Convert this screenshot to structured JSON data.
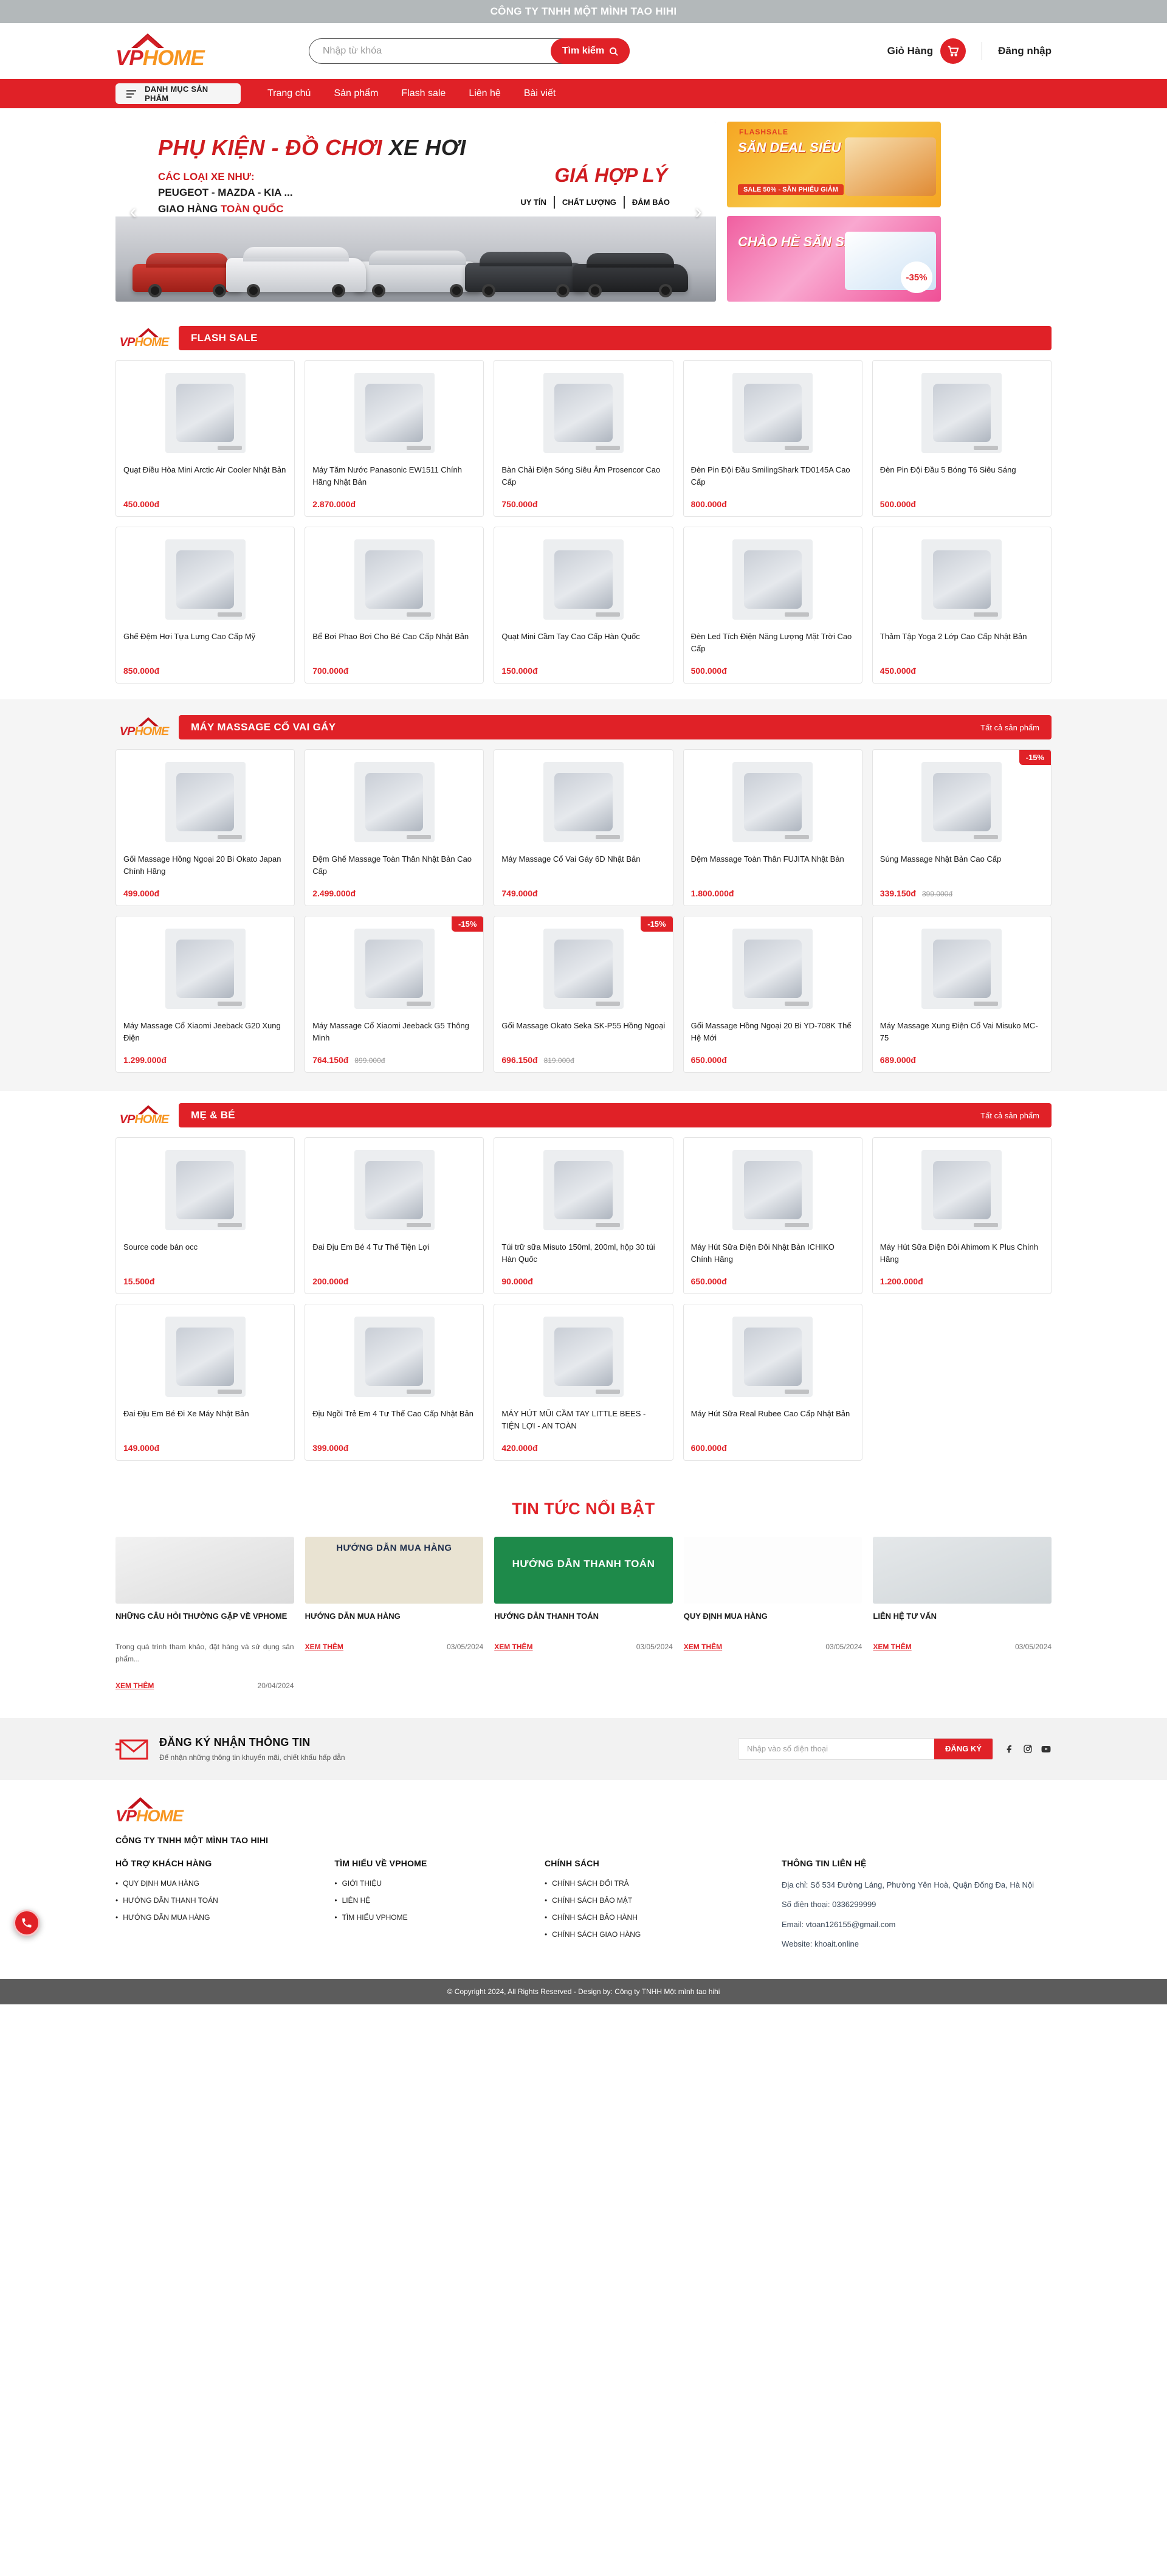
{
  "topbar": {
    "text": "CÔNG TY TNHH MỘT MÌNH TAO HIHI"
  },
  "brand": {
    "vp": "VP",
    "home": "HOME"
  },
  "search": {
    "placeholder": "Nhập từ khóa",
    "value": "",
    "button": "Tìm kiếm"
  },
  "header": {
    "cart_label": "Giỏ Hàng",
    "login_label": "Đăng nhập"
  },
  "nav": {
    "category_button": "DANH MỤC SẢN PHẨM",
    "links": [
      "Trang chủ",
      "Sản phẩm",
      "Flash sale",
      "Liên hệ",
      "Bài viết"
    ]
  },
  "banner": {
    "slide_title_red": "PHỤ KIỆN - ĐỒ CHƠI ",
    "slide_title_dark": "XE HƠI",
    "slide_sub_line1_red": "CÁC LOẠI XE NHƯ:",
    "slide_sub_line2": "PEUGEOT - MAZDA - KIA ...",
    "slide_sub_line3_pre": "GIAO HÀNG ",
    "slide_sub_line3_red": "TOÀN QUỐC",
    "slide_price": "GIÁ HỢP LÝ",
    "tags": [
      "UY TÍN",
      "CHẤT LƯỢNG",
      "ĐẢM BẢO"
    ],
    "side1_top": "FLASHSALE",
    "side1_title": "SĂN DEAL SIÊU KHỦNG",
    "side1_sub": "SALE 50% - SĂN PHIẾU GIẢM",
    "side2_title": "CHÀO HÈ SĂN SALE",
    "side2_badge": "-35%"
  },
  "flash_sale": {
    "title": "FLASH SALE",
    "products": [
      {
        "name": "Quạt Điều Hòa Mini Arctic Air Cooler Nhật Bản",
        "price": "450.000đ",
        "old_price": "",
        "discount": ""
      },
      {
        "name": "Máy Tăm Nước Panasonic EW1511 Chính Hãng Nhật Bản",
        "price": "2.870.000đ",
        "old_price": "",
        "discount": ""
      },
      {
        "name": "Bàn Chải Điện Sóng Siêu Âm Prosencor Cao Cấp",
        "price": "750.000đ",
        "old_price": "",
        "discount": ""
      },
      {
        "name": "Đèn Pin Đội Đầu SmilingShark TD0145A Cao Cấp",
        "price": "800.000đ",
        "old_price": "",
        "discount": ""
      },
      {
        "name": "Đèn Pin Đội Đầu 5 Bóng T6 Siêu Sáng",
        "price": "500.000đ",
        "old_price": "",
        "discount": ""
      },
      {
        "name": "Ghế Đệm Hơi Tựa Lưng Cao Cấp Mỹ",
        "price": "850.000đ",
        "old_price": "",
        "discount": ""
      },
      {
        "name": "Bể Bơi Phao Bơi Cho Bé Cao Cấp Nhật Bản",
        "price": "700.000đ",
        "old_price": "",
        "discount": ""
      },
      {
        "name": "Quạt Mini Cầm Tay Cao Cấp Hàn Quốc",
        "price": "150.000đ",
        "old_price": "",
        "discount": ""
      },
      {
        "name": "Đèn Led Tích Điện Năng Lượng Mặt Trời Cao Cấp",
        "price": "500.000đ",
        "old_price": "",
        "discount": ""
      },
      {
        "name": "Thảm Tập Yoga 2 Lớp Cao Cấp Nhật Bản",
        "price": "450.000đ",
        "old_price": "",
        "discount": ""
      }
    ]
  },
  "massage": {
    "title": "MÁY MASSAGE CỔ VAI GÁY",
    "all_label": "Tất cả sản phẩm",
    "products": [
      {
        "name": "Gối Massage Hồng Ngoại 20 Bi Okato Japan Chính Hãng",
        "price": "499.000đ",
        "old_price": "",
        "discount": ""
      },
      {
        "name": "Đệm Ghế Massage Toàn Thân Nhật Bản Cao Cấp",
        "price": "2.499.000đ",
        "old_price": "",
        "discount": ""
      },
      {
        "name": "Máy Massage Cổ Vai Gáy 6D Nhật Bản",
        "price": "749.000đ",
        "old_price": "",
        "discount": ""
      },
      {
        "name": "Đệm Massage Toàn Thân FUJITA Nhật Bản",
        "price": "1.800.000đ",
        "old_price": "",
        "discount": ""
      },
      {
        "name": "Súng Massage Nhật Bản Cao Cấp",
        "price": "339.150đ",
        "old_price": "399.000đ",
        "discount": "-15%"
      },
      {
        "name": "Máy Massage Cổ Xiaomi Jeeback G20 Xung Điện",
        "price": "1.299.000đ",
        "old_price": "",
        "discount": ""
      },
      {
        "name": "Máy Massage Cổ Xiaomi Jeeback G5 Thông Minh",
        "price": "764.150đ",
        "old_price": "899.000đ",
        "discount": "-15%"
      },
      {
        "name": "Gối Massage Okato Seka SK-P55 Hồng Ngoại",
        "price": "696.150đ",
        "old_price": "819.000đ",
        "discount": "-15%"
      },
      {
        "name": "Gối Massage Hồng Ngoại 20 Bi YD-708K Thế Hệ Mới",
        "price": "650.000đ",
        "old_price": "",
        "discount": ""
      },
      {
        "name": "Máy Massage Xung Điện Cổ Vai Misuko MC-75",
        "price": "689.000đ",
        "old_price": "",
        "discount": ""
      }
    ]
  },
  "baby": {
    "title": "MẸ & BÉ",
    "all_label": "Tất cả sản phẩm",
    "products": [
      {
        "name": "Source code bán occ",
        "price": "15.500đ",
        "old_price": "",
        "discount": ""
      },
      {
        "name": "Đai Địu Em Bé 4 Tư Thế Tiện Lợi",
        "price": "200.000đ",
        "old_price": "",
        "discount": ""
      },
      {
        "name": "Túi trữ sữa Misuto 150ml, 200ml, hộp 30 túi Hàn Quốc",
        "price": "90.000đ",
        "old_price": "",
        "discount": ""
      },
      {
        "name": "Máy Hút Sữa Điện Đôi Nhật Bản ICHIKO Chính Hãng",
        "price": "650.000đ",
        "old_price": "",
        "discount": ""
      },
      {
        "name": "Máy Hút Sữa Điện Đôi Ahimom K Plus Chính Hãng",
        "price": "1.200.000đ",
        "old_price": "",
        "discount": ""
      },
      {
        "name": "Đai Địu Em Bé Đi Xe Máy Nhật Bản",
        "price": "149.000đ",
        "old_price": "",
        "discount": ""
      },
      {
        "name": "Địu Ngồi Trẻ Em 4 Tư Thế Cao Cấp Nhật Bản",
        "price": "399.000đ",
        "old_price": "",
        "discount": ""
      },
      {
        "name": "MÁY HÚT MŨI CẦM TAY LITTLE BEES - TIỆN LỢI - AN TOÀN",
        "price": "420.000đ",
        "old_price": "",
        "discount": ""
      },
      {
        "name": "Máy Hút Sữa Real Rubee Cao Cấp Nhật Bản",
        "price": "600.000đ",
        "old_price": "",
        "discount": ""
      }
    ]
  },
  "news": {
    "title": "TIN TỨC NỔI BẬT",
    "more_label": "XEM THÊM",
    "items": [
      {
        "caption": "",
        "name": "NHỮNG CÂU HỎI THƯỜNG GẶP VỀ VPHOME",
        "excerpt": "Trong quá trình tham khảo, đặt hàng và sử dụng sản phẩm...",
        "date": "20/04/2024"
      },
      {
        "caption": "HƯỚNG DẪN MUA HÀNG",
        "name": "HƯỚNG DẪN MUA HÀNG",
        "excerpt": "",
        "date": "03/05/2024"
      },
      {
        "caption": "HƯỚNG DẪN THANH TOÁN",
        "name": "HƯỚNG DẪN THANH TOÁN",
        "excerpt": "",
        "date": "03/05/2024"
      },
      {
        "caption": "",
        "name": "QUY ĐỊNH MUA HÀNG",
        "excerpt": "",
        "date": "03/05/2024"
      },
      {
        "caption": "",
        "name": "LIÊN HỆ TƯ VẤN",
        "excerpt": "",
        "date": "03/05/2024"
      }
    ]
  },
  "newsletter": {
    "title": "ĐĂNG KÝ NHẬN THÔNG TIN",
    "subtitle": "Để nhận những thông tin khuyến mãi, chiết khấu hấp dẫn",
    "placeholder": "Nhập vào số điện thoại",
    "button": "ĐĂNG KÝ"
  },
  "footer": {
    "company": "CÔNG TY TNHH MỘT MÌNH TAO HIHI",
    "col1_title": "HỖ TRỢ KHÁCH HÀNG",
    "col1_items": [
      "QUY ĐỊNH MUA HÀNG",
      "HƯỚNG DẪN THANH TOÁN",
      "HƯỚNG DẪN MUA HÀNG"
    ],
    "col2_title": "TÌM HIỂU VỀ VPHOME",
    "col2_items": [
      "GIỚI THIỆU",
      "LIÊN HỆ",
      "TÌM HIỂU VPHOME"
    ],
    "col3_title": "CHÍNH SÁCH",
    "col3_items": [
      "CHÍNH SÁCH ĐỔI TRẢ",
      "CHÍNH SÁCH BẢO MẬT",
      "CHÍNH SÁCH BẢO HÀNH",
      "CHÍNH SÁCH GIAO HÀNG"
    ],
    "col4_title": "THÔNG TIN LIÊN HỆ",
    "address": "Địa chỉ: Số 534 Đường Láng, Phường Yên Hoà, Quận Đống Đa, Hà Nội",
    "phone": "Số điện thoại: 0336299999",
    "email": "Email: vtoan126155@gmail.com",
    "website": "Website: khoait.online",
    "copyright": "© Copyright 2024, All Rights Reserved - Design by: Công ty TNHH Một mình tao hihi"
  },
  "colors": {
    "primary": "#e02127",
    "accent": "#f79520",
    "topbar": "#b3b8ba"
  }
}
